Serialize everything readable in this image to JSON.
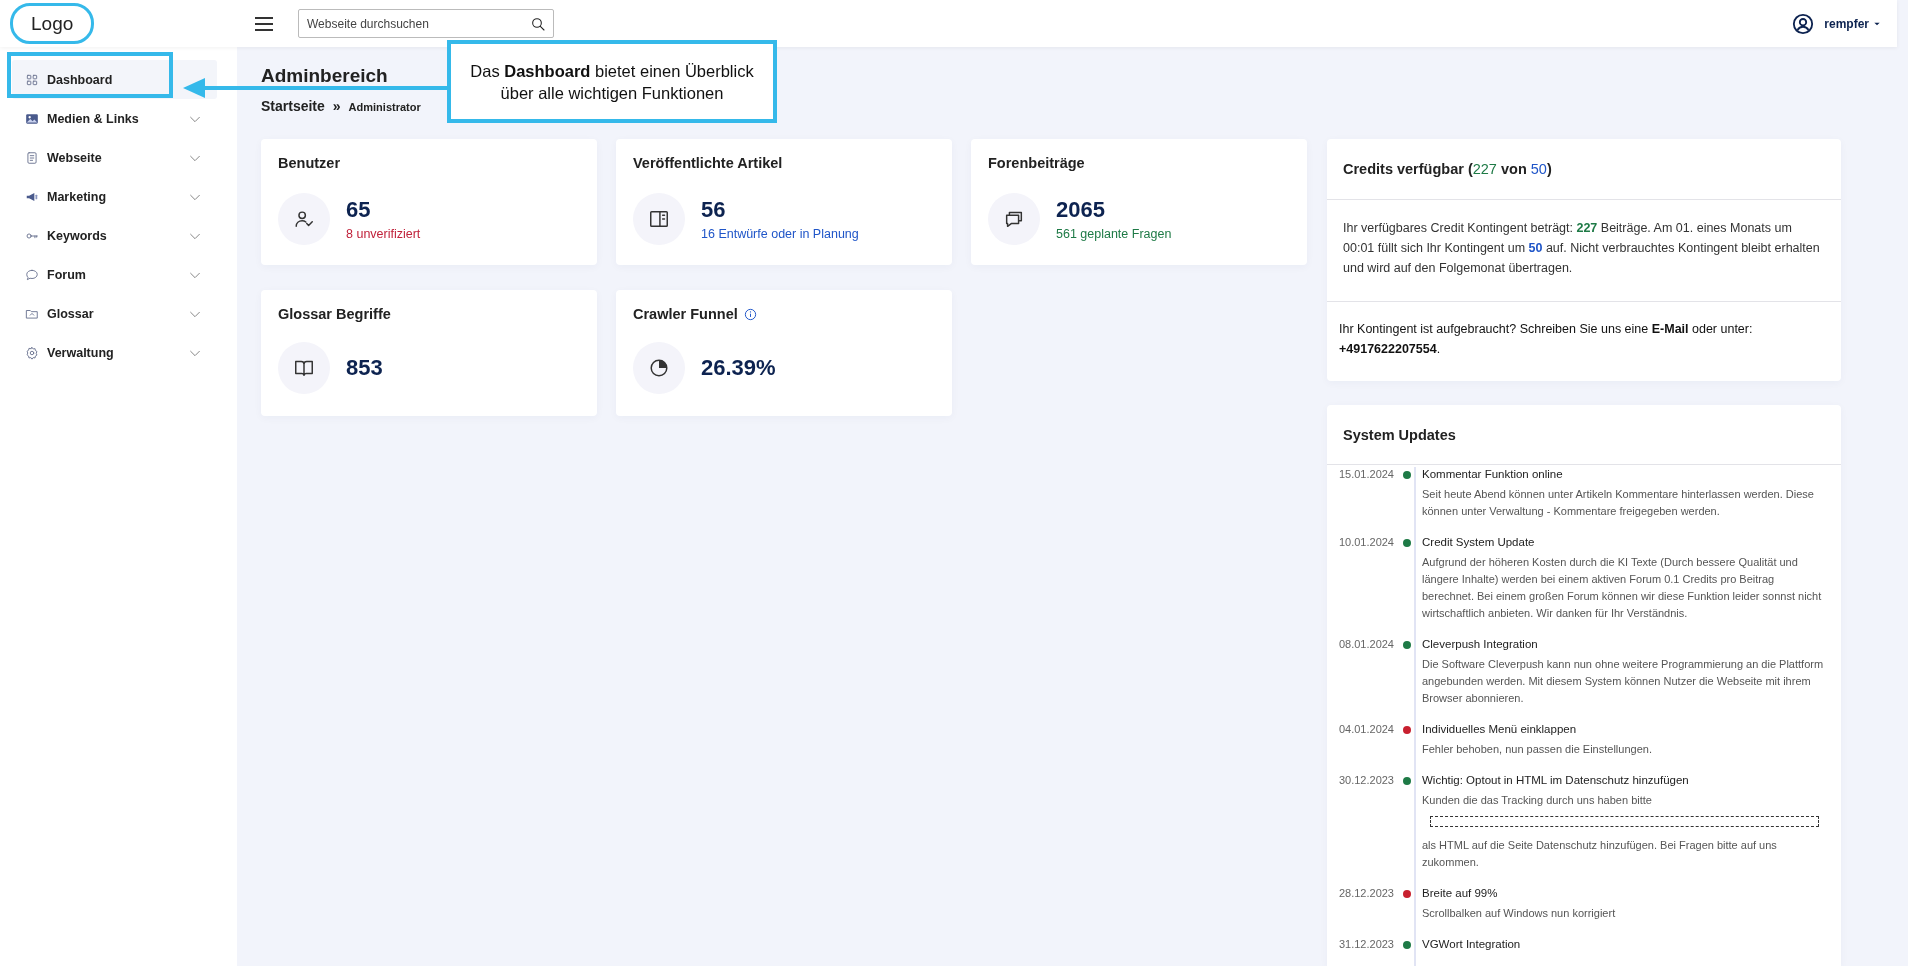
{
  "header": {
    "logo": "Logo",
    "search": {
      "placeholder": "Webseite durchsuchen"
    },
    "user": {
      "name": "rempfer"
    }
  },
  "sidebar": {
    "items": [
      {
        "label": "Dashboard",
        "kind": "grid",
        "selected": true,
        "has_submenu": false
      },
      {
        "label": "Medien & Links",
        "kind": "image",
        "selected": false,
        "has_submenu": true
      },
      {
        "label": "Webseite",
        "kind": "document",
        "selected": false,
        "has_submenu": true
      },
      {
        "label": "Marketing",
        "kind": "megaphone",
        "selected": false,
        "has_submenu": true
      },
      {
        "label": "Keywords",
        "kind": "key",
        "selected": false,
        "has_submenu": true
      },
      {
        "label": "Forum",
        "kind": "bubble",
        "selected": false,
        "has_submenu": true
      },
      {
        "label": "Glossar",
        "kind": "folder",
        "selected": false,
        "has_submenu": true
      },
      {
        "label": "Verwaltung",
        "kind": "gear",
        "selected": false,
        "has_submenu": true
      }
    ]
  },
  "page": {
    "title": "Adminbereich",
    "breadcrumb": {
      "home": "Startseite",
      "separator": "»",
      "current": "Administrator"
    }
  },
  "stats": [
    {
      "title": "Benutzer",
      "kind": "users",
      "value": "65",
      "note": "8 unverifiziert",
      "color": "#c0223b",
      "info": false
    },
    {
      "title": "Veröffentlichte Artikel",
      "kind": "columns",
      "value": "56",
      "note": "16 Entwürfe oder in Planung",
      "color": "#1f55c8",
      "info": false
    },
    {
      "title": "Forenbeiträge",
      "kind": "chat",
      "value": "2065",
      "note": "561 geplante Fragen",
      "color": "#1e7a46",
      "info": false
    },
    {
      "title": "Glossar Begriffe",
      "kind": "book",
      "value": "853",
      "info": false
    },
    {
      "title": "Crawler Funnel",
      "kind": "pie",
      "value": "26.39%",
      "info": true
    }
  ],
  "credits": {
    "title": [
      {
        "text": "Credits verfügbar ("
      },
      {
        "text": "227",
        "color": "#1e7a46"
      },
      {
        "text": " von "
      },
      {
        "text": "50",
        "color": "#1f55c8"
      },
      {
        "text": ")"
      }
    ],
    "text": [
      {
        "text": "Ihr verfügbares Credit Kontingent beträgt: "
      },
      {
        "text": "227",
        "color": "#1e7a46"
      },
      {
        "text": " Beiträge. Am 01. eines Monats um 00:01 füllt sich Ihr Kontingent um "
      },
      {
        "text": "50",
        "color": "#1f55c8"
      },
      {
        "text": " auf. Nicht verbrauchtes Kontingent bleibt erhalten und wird auf den Folgemonat übertragen."
      }
    ],
    "contact": "Ihr Kontingent ist aufgebraucht? Schreiben Sie uns eine **E-Mail** oder unter: **+4917622207554**."
  },
  "updates": {
    "title": "System Updates",
    "entries": [
      {
        "date": "15.01.2024",
        "title": "Kommentar Funktion online",
        "color": "#1e7a46",
        "body": [
          {
            "kind": "text",
            "text": "Seit heute Abend können unter Artikeln Kommentare hinterlassen werden. Diese können unter Verwaltung - Kommentare freigegeben werden."
          }
        ]
      },
      {
        "date": "10.01.2024",
        "title": "Credit System Update",
        "color": "#1e7a46",
        "body": [
          {
            "kind": "text",
            "text": "Aufgrund der höheren Kosten durch die KI Texte (Durch bessere Qualität und längere Inhalte) werden bei einem aktiven Forum 0.1 Credits pro Beitrag berechnet. Bei einem großen Forum können wir diese Funktion leider sonnst nicht wirtschaftlich anbieten. Wir danken für Ihr Verständnis."
          }
        ]
      },
      {
        "date": "08.01.2024",
        "title": "Cleverpush Integration",
        "color": "#1e7a46",
        "body": [
          {
            "kind": "text",
            "text": "Die Software Cleverpush kann nun ohne weitere Programmierung an die Plattform angebunden werden. Mit diesem System können Nutzer die Webseite mit ihrem Browser abonnieren."
          }
        ]
      },
      {
        "date": "04.01.2024",
        "title": "Individuelles Menü einklappen",
        "color": "#c8202f",
        "body": [
          {
            "kind": "text",
            "text": "Fehler behoben, nun passen die Einstellungen."
          }
        ]
      },
      {
        "date": "30.12.2023",
        "title": "Wichtig: Optout in HTML im Datenschutz hinzufügen",
        "color": "#1e7a46",
        "body": [
          {
            "kind": "text",
            "text": "Kunden die das Tracking durch uns haben bitte"
          },
          {
            "kind": "snippet"
          },
          {
            "kind": "text",
            "text": "als HTML auf die Seite Datenschutz hinzufügen. Bei Fragen bitte auf uns zukommen."
          }
        ]
      },
      {
        "date": "28.12.2023",
        "title": "Breite auf 99%",
        "color": "#c8202f",
        "body": [
          {
            "kind": "text",
            "text": "Scrollbalken auf Windows nun korrigiert"
          }
        ]
      },
      {
        "date": "31.12.2023",
        "title": "VGWort Integration",
        "color": "#1e7a46"
      }
    ]
  },
  "annotation": {
    "callout": "Das **Dashboard** bietet einen Überblick über alle wichtigen Funktionen"
  }
}
